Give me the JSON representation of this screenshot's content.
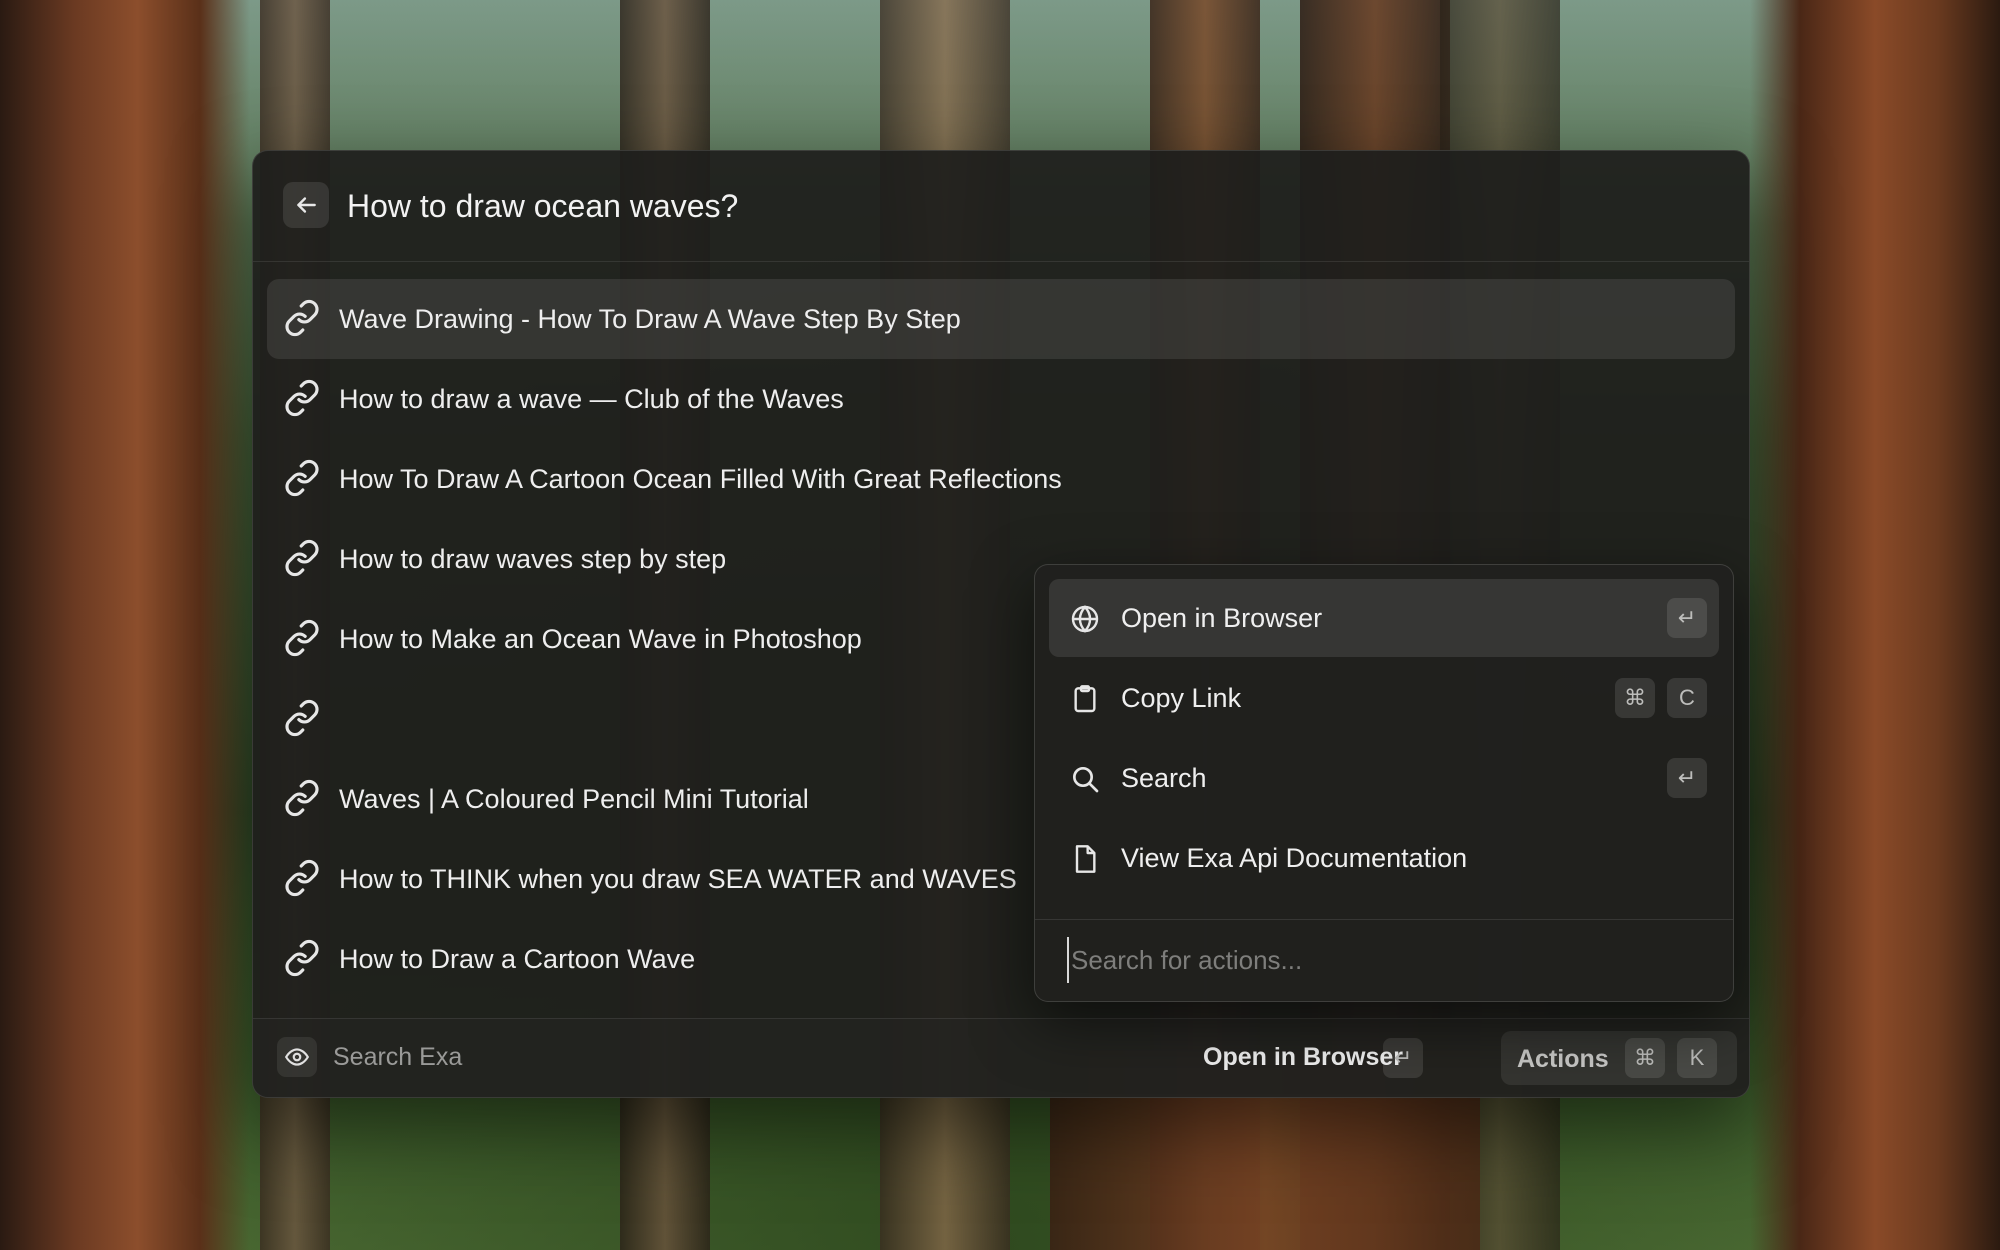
{
  "header": {
    "query": "How to draw ocean waves?",
    "back_icon": "arrow-left-icon"
  },
  "results": [
    {
      "label": "Wave Drawing - How To Draw A Wave Step By Step",
      "selected": true
    },
    {
      "label": "How to draw a wave — Club of the Waves"
    },
    {
      "label": "How To Draw A Cartoon Ocean Filled With Great Reflections"
    },
    {
      "label": "How to draw waves step by step"
    },
    {
      "label": "How to Make an Ocean Wave in Photoshop"
    },
    {
      "label": ""
    },
    {
      "label": "Waves | A Coloured Pencil Mini Tutorial"
    },
    {
      "label": "How to THINK when you draw SEA WATER and WAVES"
    },
    {
      "label": "How to Draw a Cartoon Wave"
    }
  ],
  "actions_menu": {
    "items": [
      {
        "label": "Open in Browser",
        "icon": "globe-icon",
        "shortcut": [
          "↵"
        ],
        "selected": true
      },
      {
        "label": "Copy Link",
        "icon": "clipboard-icon",
        "shortcut": [
          "⌘",
          "C"
        ]
      },
      {
        "label": "Search",
        "icon": "search-icon",
        "shortcut": [
          "↵"
        ]
      },
      {
        "label": "View Exa Api Documentation",
        "icon": "document-icon",
        "shortcut": []
      }
    ],
    "search_placeholder": "Search for actions..."
  },
  "footer": {
    "extension_title": "Search Exa",
    "logo_icon": "exa-eye-icon",
    "primary_action": "Open in Browser",
    "primary_shortcut": "↵",
    "actions_label": "Actions",
    "actions_shortcut": [
      "⌘",
      "K"
    ]
  }
}
